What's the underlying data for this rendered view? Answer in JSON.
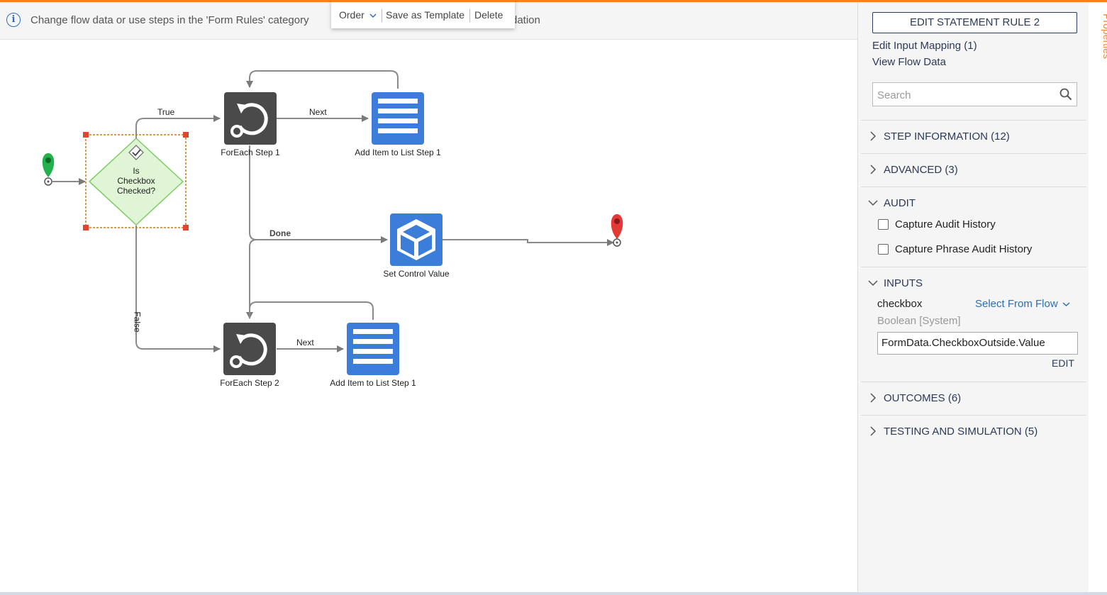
{
  "info_bar": {
    "text": "Change flow data or use steps in the 'Form Rules' category",
    "text_tail": "dation"
  },
  "context_menu": {
    "order_label": "Order",
    "save_template_label": "Save as Template",
    "delete_label": "Delete"
  },
  "canvas": {
    "nodes": {
      "decision_label": [
        "Is",
        "Checkbox",
        "Checked?"
      ],
      "foreach1": "ForEach Step 1",
      "add_item1": "Add Item to List Step 1",
      "set_control": "Set Control Value",
      "foreach2": "ForEach Step 2",
      "add_item2": "Add Item to List Step 1"
    },
    "edges": {
      "true_label": "True",
      "false_label": "False",
      "next1_label": "Next",
      "done_label": "Done",
      "next2_label": "Next"
    }
  },
  "panel": {
    "rule_button": "EDIT STATEMENT RULE 2",
    "edit_input_mapping": "Edit Input Mapping (1)",
    "view_flow_data": "View Flow Data",
    "search_placeholder": "Search",
    "sections": {
      "step_information": "STEP INFORMATION (12)",
      "advanced": "ADVANCED (3)",
      "audit": "AUDIT",
      "inputs": "INPUTS",
      "outcomes": "OUTCOMES (6)",
      "testing": "TESTING AND SIMULATION (5)"
    },
    "audit": {
      "capture_audit": "Capture Audit History",
      "capture_phrase": "Capture Phrase Audit History"
    },
    "inputs": {
      "name": "checkbox",
      "select": "Select From Flow",
      "type": "Boolean [System]",
      "value": "FormData.CheckboxOutside.Value",
      "edit": "EDIT"
    }
  },
  "side_tab": {
    "label": "Properties"
  },
  "colors": {
    "accent": "#f58220",
    "node_dark": "#4a4a4a",
    "node_blue": "#3b7dd8",
    "link": "#2a6fb8",
    "start_pin": "#22b14c",
    "end_pin": "#e53935",
    "decision_fill": "#dff5d5"
  }
}
